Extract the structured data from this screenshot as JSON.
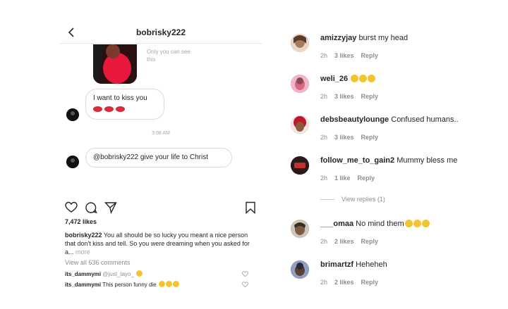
{
  "left": {
    "header_title": "bobrisky222",
    "shared_note": "Only you can see this",
    "message1": "I want to kiss you",
    "timestamp": "3:08 AM",
    "message2": "@bobrisky222 give your life to Christ",
    "likes": "7,472 likes",
    "caption_user": "bobrisky222",
    "caption_text": " You all should be so lucky you meant a nice person that don't kiss and tell. So you were dreaming when you asked for a...",
    "caption_more": " more",
    "view_all": "View all 636 comments",
    "comments": [
      {
        "user": "its_dammymi",
        "text": " @just_tayo_"
      },
      {
        "user": "its_dammymi",
        "text": " This person funny die"
      }
    ]
  },
  "right": {
    "comments": [
      {
        "user": "amizzyjay",
        "text": "burst my head",
        "time": "2h",
        "likes": "3 likes",
        "reply": "Reply",
        "avatar_color": "#c9a48a"
      },
      {
        "user": "weli_26",
        "text": "",
        "time": "2h",
        "likes": "3 likes",
        "reply": "Reply",
        "avatar_color": "#d77fa1"
      },
      {
        "user": "debsbeautylounge",
        "text": " Confused humans..",
        "time": "2h",
        "likes": "3 likes",
        "reply": "Reply",
        "avatar_color": "#b22222"
      },
      {
        "user": "follow_me_to_gain2",
        "text": " Mummy bless me",
        "time": "2h",
        "likes": "1 like",
        "reply": "Reply",
        "avatar_color": "#3a1f1f"
      },
      {
        "user": "___omaa",
        "text": " No mind them",
        "time": "2h",
        "likes": "2 likes",
        "reply": "Reply",
        "avatar_color": "#8a7a6a"
      },
      {
        "user": "brimartzf",
        "text": " Heheheh",
        "time": "2h",
        "likes": "2 likes",
        "reply": "Reply",
        "avatar_color": "#4a5a7a"
      }
    ],
    "view_replies": "View replies (1)"
  }
}
